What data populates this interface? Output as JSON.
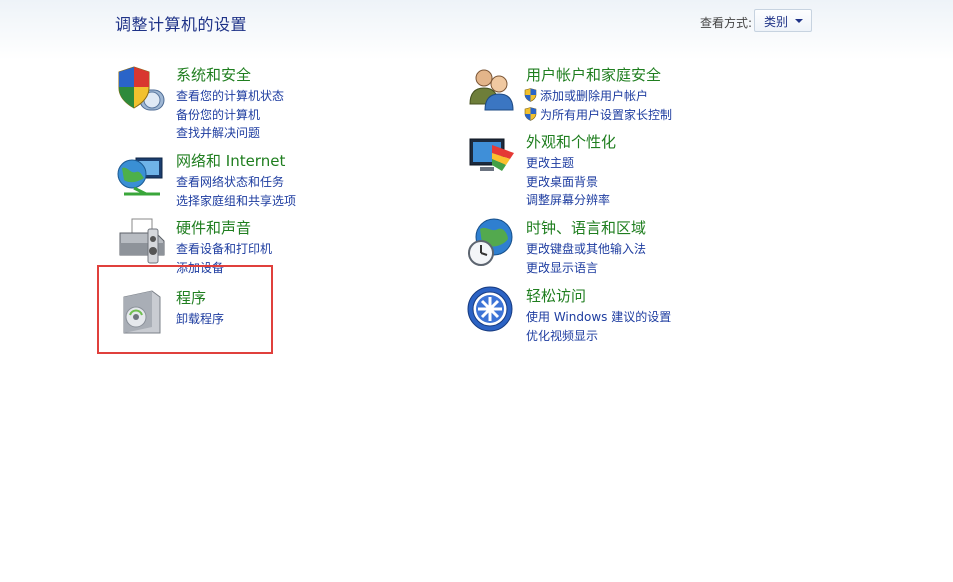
{
  "header": {
    "title": "调整计算机的设置",
    "view_by_label": "查看方式:",
    "view_by_value": "类别"
  },
  "categories": {
    "system": {
      "title": "系统和安全",
      "links": [
        "查看您的计算机状态",
        "备份您的计算机",
        "查找并解决问题"
      ],
      "icon": "shield-computer-icon"
    },
    "network": {
      "title": "网络和 Internet",
      "links": [
        "查看网络状态和任务",
        "选择家庭组和共享选项"
      ],
      "icon": "network-globe-icon"
    },
    "hardware": {
      "title": "硬件和声音",
      "links": [
        "查看设备和打印机",
        "添加设备"
      ],
      "icon": "printer-icon"
    },
    "programs": {
      "title": "程序",
      "links": [
        "卸载程序"
      ],
      "icon": "programs-box-icon"
    },
    "users": {
      "title": "用户帐户和家庭安全",
      "links": [
        "添加或删除用户帐户",
        "为所有用户设置家长控制"
      ],
      "icon": "users-icon"
    },
    "appearance": {
      "title": "外观和个性化",
      "links": [
        "更改主题",
        "更改桌面背景",
        "调整屏幕分辨率"
      ],
      "icon": "monitor-palette-icon"
    },
    "clock": {
      "title": "时钟、语言和区域",
      "links": [
        "更改键盘或其他输入法",
        "更改显示语言"
      ],
      "icon": "globe-clock-icon"
    },
    "ease": {
      "title": "轻松访问",
      "links": [
        "使用 Windows 建议的设置",
        "优化视频显示"
      ],
      "icon": "ease-of-access-icon"
    }
  },
  "colors": {
    "title_green": "#1f7e1f",
    "link_blue": "#1e3da0",
    "highlight_red": "#e0403c"
  }
}
